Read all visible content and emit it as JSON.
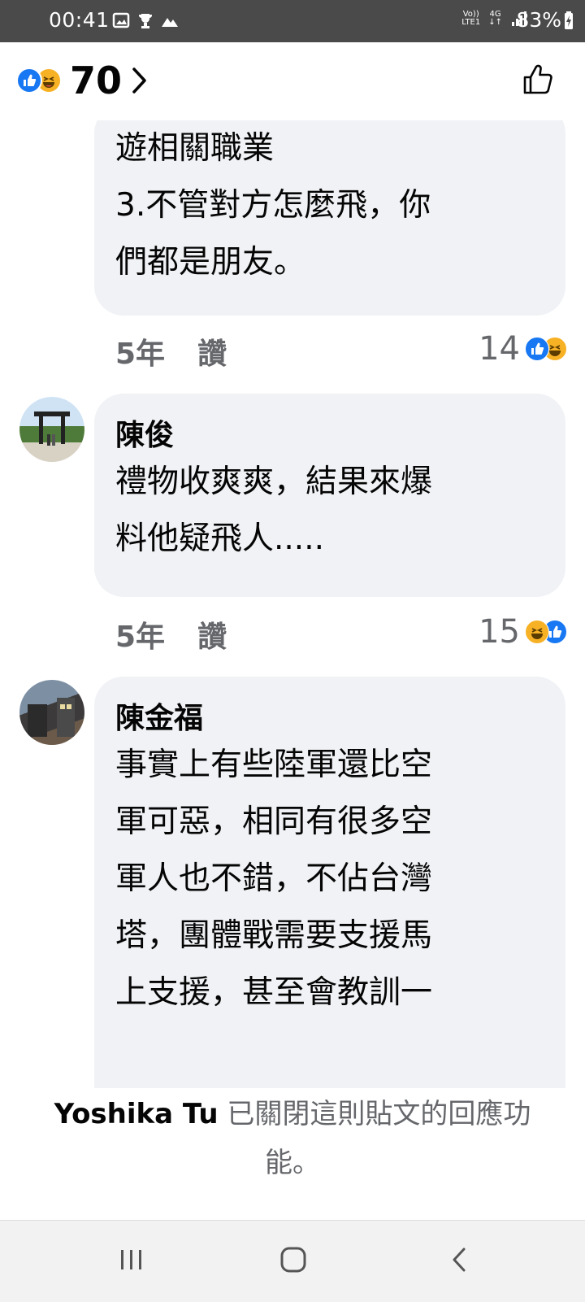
{
  "status_bar": {
    "time": "00:41",
    "network_volte": "Vo))",
    "network_lte": "LTE1",
    "network_type": "4G",
    "battery": "83%"
  },
  "header": {
    "reaction_count": "70",
    "reaction_icons": [
      "like-icon",
      "haha-icon"
    ]
  },
  "comments": [
    {
      "author": "",
      "text": "遊相關職業\n3.不管對方怎麼飛，你\n們都是朋友。",
      "time": "5年",
      "like_label": "讚",
      "reaction_count": "14",
      "reaction_icons": [
        "like-icon",
        "haha-icon"
      ]
    },
    {
      "author": "陳俊",
      "text": "禮物收爽爽，結果來爆\n料他疑飛人.....",
      "time": "5年",
      "like_label": "讚",
      "reaction_count": "15",
      "reaction_icons": [
        "haha-icon",
        "like-icon"
      ]
    },
    {
      "author": "陳金福",
      "text": "事實上有些陸軍還比空\n軍可惡，相同有很多空\n軍人也不錯，不佔台灣\n塔，團體戰需要支援馬\n上支援，甚至會教訓一"
    }
  ],
  "closed_notice": {
    "name": "Yoshika Tu",
    "line1": "已關閉這則貼文的回應功",
    "line2": "能。"
  },
  "colors": {
    "like_blue": "#1877f2",
    "haha_yellow": "#f7b125",
    "bubble_bg": "#f0f2f5",
    "meta_gray": "#65676b"
  }
}
